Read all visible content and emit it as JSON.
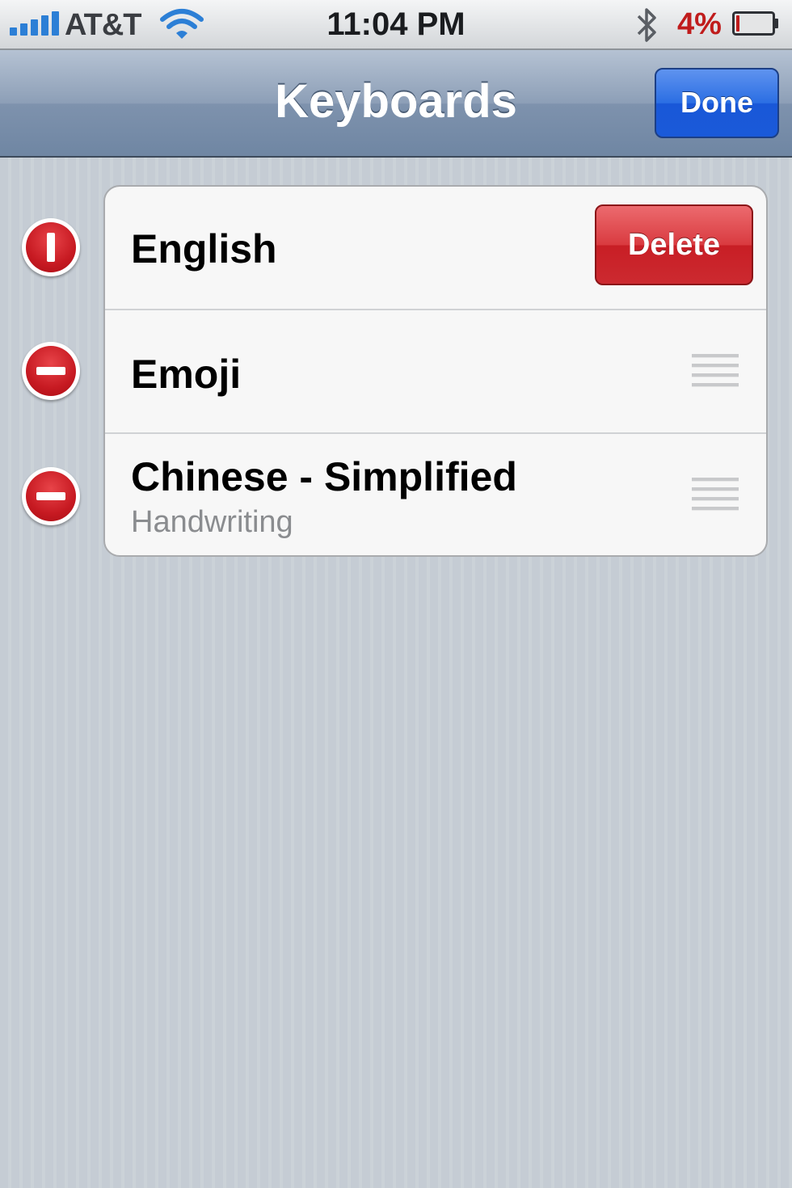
{
  "status_bar": {
    "carrier": "AT&T",
    "time": "11:04 PM",
    "battery_percent": "4%",
    "battery_level": 0.04,
    "signal_bars": 5,
    "icons": [
      "signal-icon",
      "wifi-icon",
      "bluetooth-icon",
      "battery-icon"
    ],
    "colors": {
      "signal": "#2c7fd6",
      "battery_low": "#c01c1c"
    }
  },
  "nav_bar": {
    "title": "Keyboards",
    "done_label": "Done",
    "colors": {
      "done_button": "#2b6ee3"
    }
  },
  "keyboards": {
    "items": [
      {
        "label": "English",
        "sublabel": "",
        "state": "delete-confirm",
        "delete_label": "Delete"
      },
      {
        "label": "Emoji",
        "sublabel": "",
        "state": "reorder"
      },
      {
        "label": "Chinese - Simplified",
        "sublabel": "Handwriting",
        "state": "reorder"
      }
    ],
    "colors": {
      "delete_button": "#d93b40",
      "edit_control": "#c71a22"
    }
  }
}
